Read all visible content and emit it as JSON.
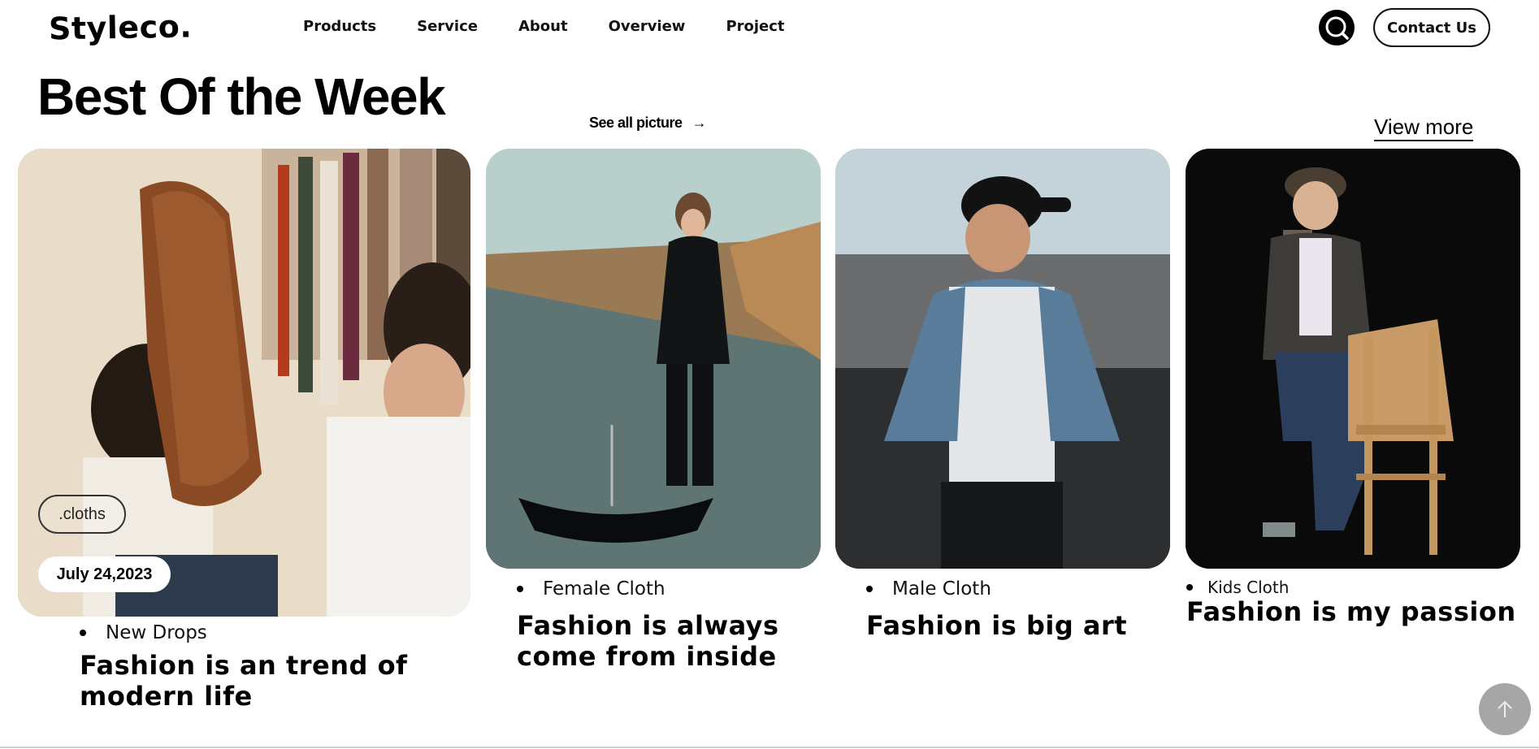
{
  "header": {
    "logo": "Styleco.",
    "nav": [
      "Products",
      "Service",
      "About",
      "Overview",
      "Project"
    ],
    "contact_label": "Contact Us",
    "search_icon": "search-icon"
  },
  "section": {
    "title": "Best Of the Week",
    "see_all": "See all picture",
    "see_all_arrow": "→",
    "view_more": "View more"
  },
  "cards": [
    {
      "tag": ".cloths",
      "date": "July 24,2023",
      "category": "New Drops",
      "headline_line1": "Fashion is an trend of",
      "headline_line2": "modern life"
    },
    {
      "category": "Female Cloth",
      "headline_line1": "Fashion is always",
      "headline_line2": "come from inside"
    },
    {
      "category": "Male Cloth",
      "headline_line1": "Fashion is big art"
    },
    {
      "category": "Kids Cloth",
      "headline_line1": "Fashion is my passion"
    }
  ],
  "scroll_top_icon": "arrow-up-icon",
  "colors": {
    "accent": "#000000",
    "scroll_button": "#a6a6a6"
  }
}
